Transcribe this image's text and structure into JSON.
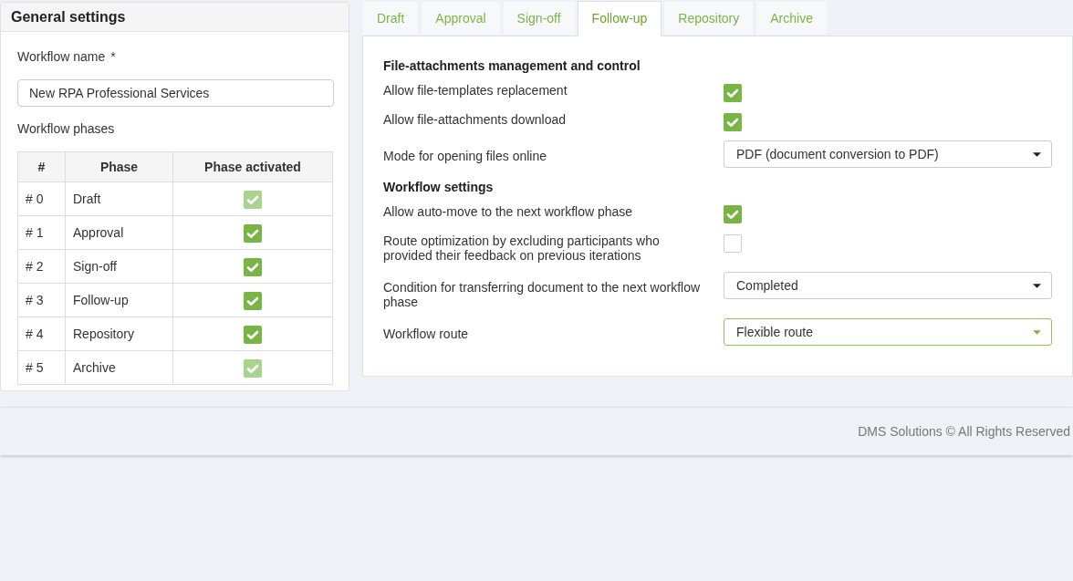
{
  "general_settings": {
    "title": "General settings",
    "workflow_name": {
      "label": "Workflow name",
      "required_mark": "*",
      "value": "New RPA Professional Services"
    },
    "phases_label": "Workflow phases",
    "table": {
      "columns": [
        "#",
        "Phase",
        "Phase activated"
      ],
      "rows": [
        {
          "index": "# 0",
          "phase": "Draft",
          "checked": true,
          "disabled": true
        },
        {
          "index": "# 1",
          "phase": "Approval",
          "checked": true,
          "disabled": false
        },
        {
          "index": "# 2",
          "phase": "Sign-off",
          "checked": true,
          "disabled": false
        },
        {
          "index": "# 3",
          "phase": "Follow-up",
          "checked": true,
          "disabled": false
        },
        {
          "index": "# 4",
          "phase": "Repository",
          "checked": true,
          "disabled": false
        },
        {
          "index": "# 5",
          "phase": "Archive",
          "checked": true,
          "disabled": true
        }
      ]
    }
  },
  "tabs": [
    {
      "label": "Draft",
      "selected": false
    },
    {
      "label": "Approval",
      "selected": false
    },
    {
      "label": "Sign-off",
      "selected": false
    },
    {
      "label": "Follow-up",
      "selected": true
    },
    {
      "label": "Repository",
      "selected": false
    },
    {
      "label": "Archive",
      "selected": false
    }
  ],
  "sections": [
    {
      "title": "File-attachments management and control",
      "rows": [
        {
          "kind": "checkbox",
          "label": "Allow file-templates replacement",
          "checked": true
        },
        {
          "kind": "checkbox",
          "label": "Allow file-attachments download",
          "checked": true
        },
        {
          "kind": "select",
          "label": "Mode for opening files online",
          "value": "PDF (document conversion to PDF)",
          "focused": false
        }
      ]
    },
    {
      "title": "Workflow settings",
      "rows": [
        {
          "kind": "checkbox",
          "label": "Allow auto-move to the next workflow phase",
          "checked": true
        },
        {
          "kind": "checkbox",
          "label": "Route optimization by excluding participants who provided their feedback on previous iterations",
          "checked": false
        },
        {
          "kind": "select",
          "label": "Condition for transferring document to the next workflow phase",
          "value": "Completed",
          "focused": false
        },
        {
          "kind": "select",
          "label": "Workflow route",
          "value": "Flexible route",
          "focused": true
        }
      ]
    }
  ],
  "footer": "DMS Solutions © All Rights Reserved"
}
